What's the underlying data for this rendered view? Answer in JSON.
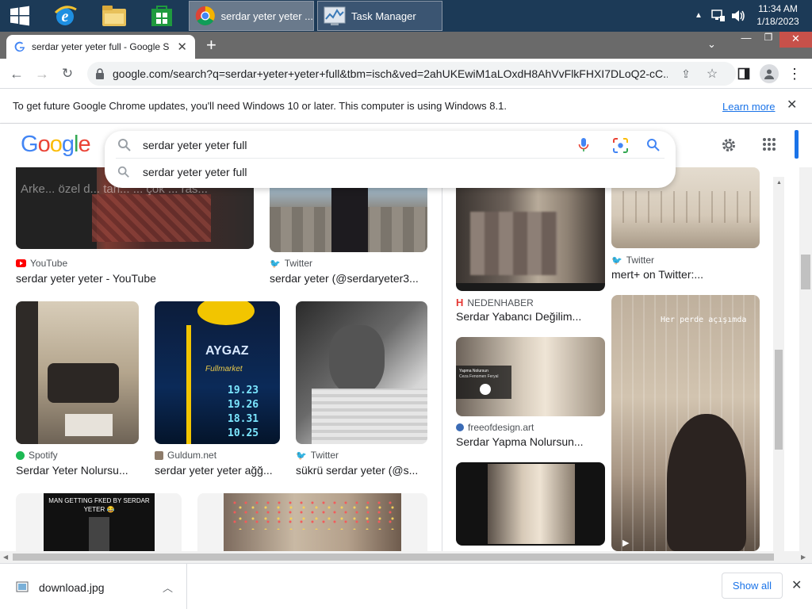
{
  "taskbar": {
    "apps": [
      {
        "label": "serdar yeter yeter ...",
        "icon": "chrome-icon"
      },
      {
        "label": "Task Manager",
        "icon": "task-manager-icon"
      }
    ],
    "clock": {
      "time": "11:34 AM",
      "date": "1/18/2023"
    }
  },
  "browser": {
    "tab_title": "serdar yeter yeter full - Google S",
    "url": "google.com/search?q=serdar+yeter+yeter+full&tbm=isch&ved=2ahUKEwiM1aLOxdH8AhVvFlkFHXI7DLoQ2-cC..."
  },
  "infobar": {
    "message": "To get future Google Chrome updates, you'll need Windows 10 or later. This computer is using Windows 8.1.",
    "link": "Learn more"
  },
  "search": {
    "logo": "Google",
    "query": "serdar yeter yeter full",
    "suggestion": "serdar yeter yeter full"
  },
  "results_left": [
    {
      "source": "YouTube",
      "title": "serdar yeter yeter - YouTube"
    },
    {
      "source": "Twitter",
      "title": "serdar yeter (@serdaryeter3..."
    },
    {
      "source": "Spotify",
      "title": "Serdar Yeter Nolursu..."
    },
    {
      "source": "Guldum.net",
      "title": "serdar yeter yeter ağğ..."
    },
    {
      "source": "Twitter",
      "title": "sükrü serdar yeter (@s..."
    }
  ],
  "image_texts": {
    "yt_overlay": "Arke... özel d... tan... ... çok ... ras...",
    "aygaz_brand": "AYGAZ",
    "aygaz_sub": "Fullmarket",
    "prices": [
      "19.23",
      "19.26",
      "18.31",
      "10.25"
    ],
    "meme": "MAN GETTING FKED BY SERDAR YETER 😂",
    "video_caption": "Her perde açışımda",
    "player_title": "Yapma Nolursun",
    "player_sub": "Ceza Fenomen Feryal"
  },
  "results_right": [
    {
      "source": "Twitter",
      "title": "mert+ on Twitter:..."
    },
    {
      "source": "NEDENHABER",
      "title": "Serdar Yabancı Değilim..."
    },
    {
      "source": "freeofdesign.art",
      "title": "Serdar Yapma Nolursun..."
    }
  ],
  "downloads": {
    "file": "download.jpg",
    "show_all": "Show all"
  },
  "colors": {
    "taskbar": "#1c3a57",
    "google_blue": "#4285f4",
    "google_red": "#ea4335",
    "google_yellow": "#fbbc05",
    "google_green": "#34a853",
    "link": "#1a0dab"
  }
}
